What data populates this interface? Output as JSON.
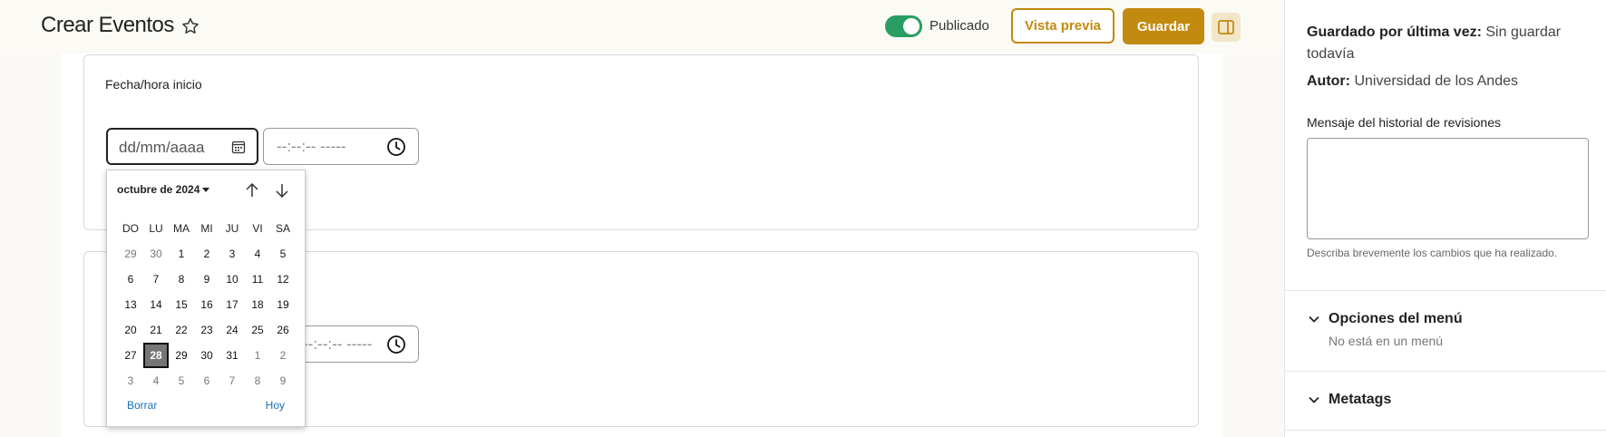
{
  "header": {
    "title": "Crear Eventos",
    "published_label": "Publicado",
    "preview_label": "Vista previa",
    "save_label": "Guardar"
  },
  "form": {
    "start_label": "Fecha/hora inicio",
    "date_placeholder": "dd/mm/aaaa",
    "time_placeholder": "--:--:-- -----"
  },
  "calendar": {
    "month_label": "octubre de 2024",
    "weekdays": [
      "DO",
      "LU",
      "MA",
      "MI",
      "JU",
      "VI",
      "SA"
    ],
    "days": [
      [
        "29",
        "30",
        "1",
        "2",
        "3",
        "4",
        "5"
      ],
      [
        "6",
        "7",
        "8",
        "9",
        "10",
        "11",
        "12"
      ],
      [
        "13",
        "14",
        "15",
        "16",
        "17",
        "18",
        "19"
      ],
      [
        "20",
        "21",
        "22",
        "23",
        "24",
        "25",
        "26"
      ],
      [
        "27",
        "28",
        "29",
        "30",
        "31",
        "1",
        "2"
      ],
      [
        "3",
        "4",
        "5",
        "6",
        "7",
        "8",
        "9"
      ]
    ],
    "selected_day": "28",
    "clear_label": "Borrar",
    "today_label": "Hoy"
  },
  "sidebar": {
    "last_saved_key": "Guardado por última vez:",
    "last_saved_value": "Sin guardar todavía",
    "author_key": "Autor:",
    "author_value": "Universidad de los Andes",
    "revision_label": "Mensaje del historial de revisiones",
    "revision_help": "Describa brevemente los cambios que ha realizado.",
    "menu_options_label": "Opciones del menú",
    "menu_options_value": "No está en un menú",
    "metatags_label": "Metatags"
  },
  "colors": {
    "accent": "#c28a0e",
    "toggle_on": "#2a9d62",
    "link": "#1a6fb5"
  }
}
